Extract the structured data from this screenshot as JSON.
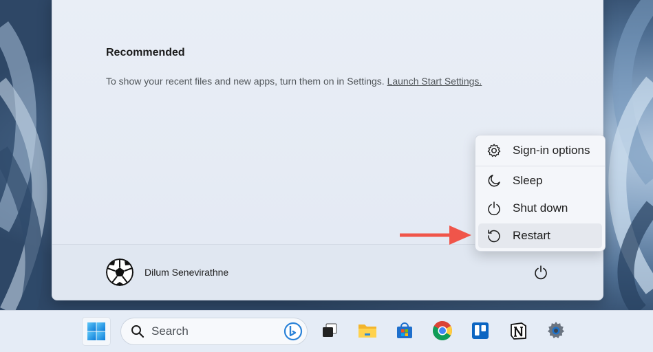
{
  "recommended": {
    "title": "Recommended",
    "text": "To show your recent files and new apps, turn them on in Settings. ",
    "link": "Launch Start Settings."
  },
  "user": {
    "name": "Dilum Senevirathne"
  },
  "power_menu": {
    "items": [
      {
        "label": "Sign-in options",
        "icon": "gear-icon"
      },
      {
        "label": "Sleep",
        "icon": "moon-icon"
      },
      {
        "label": "Shut down",
        "icon": "power-icon"
      },
      {
        "label": "Restart",
        "icon": "restart-icon",
        "highlighted": true
      }
    ]
  },
  "taskbar": {
    "search_placeholder": "Search",
    "apps": [
      "start",
      "search",
      "task-view",
      "file-explorer",
      "microsoft-store",
      "chrome",
      "trello",
      "notion",
      "settings"
    ]
  },
  "colors": {
    "arrow": "#f0554a",
    "accent": "#0078d4"
  }
}
